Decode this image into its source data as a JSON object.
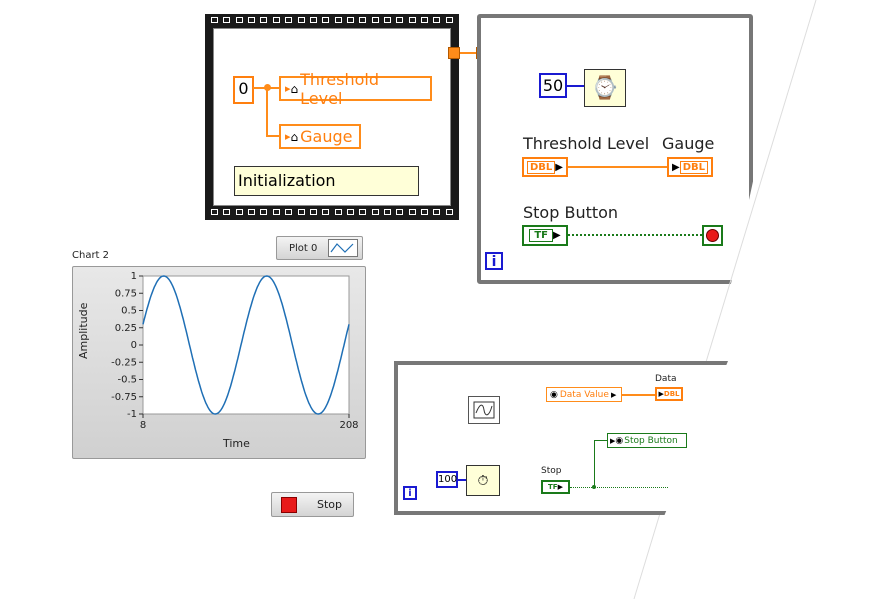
{
  "sequence": {
    "const_value": "0",
    "local_threshold": "Threshold Level",
    "local_gauge": "Gauge",
    "comment": "Initialization"
  },
  "loop1": {
    "wait_const": "50",
    "threshold_label": "Threshold Level",
    "gauge_label": "Gauge",
    "dbl_text": "DBL",
    "stop_label": "Stop Button",
    "tf_text": "TF",
    "iter_text": "i"
  },
  "chart": {
    "label": "Chart 2",
    "legend_label": "Plot 0",
    "stop_button": "Stop"
  },
  "chart_data": {
    "type": "line",
    "title": "",
    "xlabel": "Time",
    "ylabel": "Amplitude",
    "xlim": [
      8,
      208
    ],
    "ylim": [
      -1,
      1
    ],
    "x_ticks": [
      "8",
      "208"
    ],
    "y_ticks": [
      "1",
      "0.75",
      "0.5",
      "0.25",
      "0",
      "-0.25",
      "-0.5",
      "-0.75",
      "-1"
    ],
    "series": [
      {
        "name": "Plot 0",
        "function": "sine",
        "period": 100,
        "phase_x": 8,
        "y_at_start": 0.3,
        "color": "#1f6fb5"
      }
    ],
    "grid": false
  },
  "loop2": {
    "data_value": "Data Value",
    "data_label": "Data",
    "dbl_text": "DBL",
    "stop_local": "Stop Button",
    "stop_label": "Stop",
    "tf_text": "TF",
    "wait_const": "100",
    "iter_text": "i"
  }
}
